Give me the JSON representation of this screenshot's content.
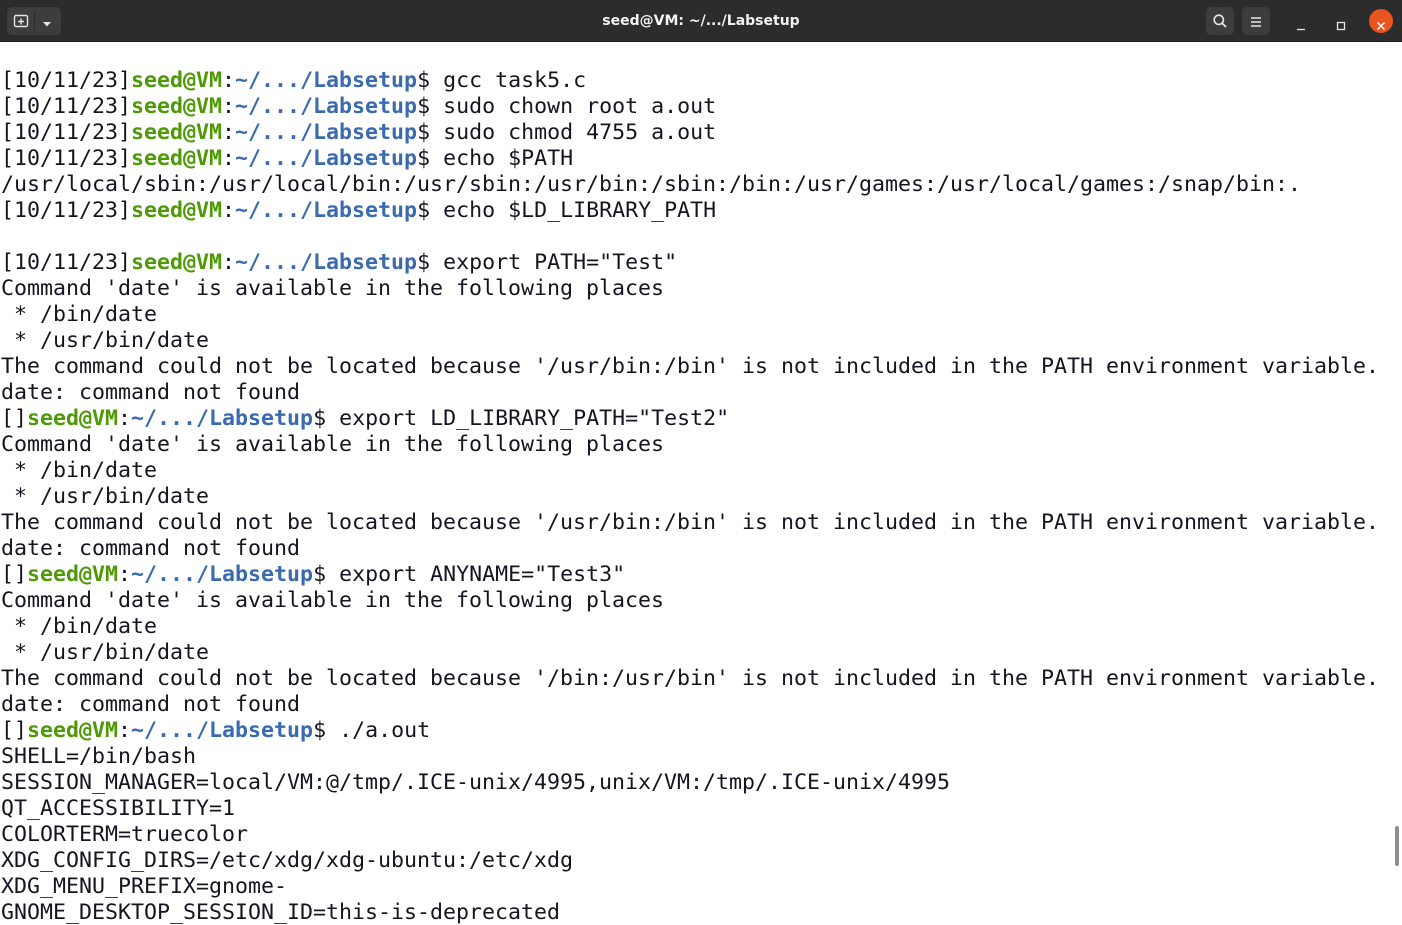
{
  "window": {
    "title": "seed@VM: ~/.../Labsetup"
  },
  "titlebar": {
    "new_tab_icon": "new-tab-icon",
    "tab_menu_icon": "chevron-down-icon",
    "search_icon": "search-icon",
    "menu_icon": "hamburger-menu-icon",
    "minimize_icon": "minimize-icon",
    "maximize_icon": "maximize-icon",
    "close_icon": "close-icon",
    "close_color": "#e95420"
  },
  "colors": {
    "user_host": "#4e9a06",
    "path": "#3a6bb0",
    "text": "#171421"
  },
  "terminal": {
    "lines": [
      {
        "type": "prompt",
        "date": "[10/11/23]",
        "user": "seed@VM",
        "sep": ":",
        "path": "~/.../Labsetup",
        "sym": "$ ",
        "cmd": "gcc task5.c"
      },
      {
        "type": "prompt",
        "date": "[10/11/23]",
        "user": "seed@VM",
        "sep": ":",
        "path": "~/.../Labsetup",
        "sym": "$ ",
        "cmd": "sudo chown root a.out"
      },
      {
        "type": "prompt",
        "date": "[10/11/23]",
        "user": "seed@VM",
        "sep": ":",
        "path": "~/.../Labsetup",
        "sym": "$ ",
        "cmd": "sudo chmod 4755 a.out"
      },
      {
        "type": "prompt",
        "date": "[10/11/23]",
        "user": "seed@VM",
        "sep": ":",
        "path": "~/.../Labsetup",
        "sym": "$ ",
        "cmd": "echo $PATH"
      },
      {
        "type": "text",
        "text": "/usr/local/sbin:/usr/local/bin:/usr/sbin:/usr/bin:/sbin:/bin:/usr/games:/usr/local/games:/snap/bin:."
      },
      {
        "type": "prompt",
        "date": "[10/11/23]",
        "user": "seed@VM",
        "sep": ":",
        "path": "~/.../Labsetup",
        "sym": "$ ",
        "cmd": "echo $LD_LIBRARY_PATH"
      },
      {
        "type": "text",
        "text": ""
      },
      {
        "type": "prompt",
        "date": "[10/11/23]",
        "user": "seed@VM",
        "sep": ":",
        "path": "~/.../Labsetup",
        "sym": "$ ",
        "cmd": "export PATH=\"Test\""
      },
      {
        "type": "text",
        "text": "Command 'date' is available in the following places"
      },
      {
        "type": "text",
        "text": " * /bin/date"
      },
      {
        "type": "text",
        "text": " * /usr/bin/date"
      },
      {
        "type": "text",
        "text": "The command could not be located because '/usr/bin:/bin' is not included in the PATH environment variable."
      },
      {
        "type": "text",
        "text": "date: command not found"
      },
      {
        "type": "prompt",
        "date": "[]",
        "user": "seed@VM",
        "sep": ":",
        "path": "~/.../Labsetup",
        "sym": "$ ",
        "cmd": "export LD_LIBRARY_PATH=\"Test2\""
      },
      {
        "type": "text",
        "text": "Command 'date' is available in the following places"
      },
      {
        "type": "text",
        "text": " * /bin/date"
      },
      {
        "type": "text",
        "text": " * /usr/bin/date"
      },
      {
        "type": "text",
        "text": "The command could not be located because '/usr/bin:/bin' is not included in the PATH environment variable."
      },
      {
        "type": "text",
        "text": "date: command not found"
      },
      {
        "type": "prompt",
        "date": "[]",
        "user": "seed@VM",
        "sep": ":",
        "path": "~/.../Labsetup",
        "sym": "$ ",
        "cmd": "export ANYNAME=\"Test3\""
      },
      {
        "type": "text",
        "text": "Command 'date' is available in the following places"
      },
      {
        "type": "text",
        "text": " * /bin/date"
      },
      {
        "type": "text",
        "text": " * /usr/bin/date"
      },
      {
        "type": "text",
        "text": "The command could not be located because '/bin:/usr/bin' is not included in the PATH environment variable."
      },
      {
        "type": "text",
        "text": "date: command not found"
      },
      {
        "type": "prompt",
        "date": "[]",
        "user": "seed@VM",
        "sep": ":",
        "path": "~/.../Labsetup",
        "sym": "$ ",
        "cmd": "./a.out"
      },
      {
        "type": "text",
        "text": "SHELL=/bin/bash"
      },
      {
        "type": "text",
        "text": "SESSION_MANAGER=local/VM:@/tmp/.ICE-unix/4995,unix/VM:/tmp/.ICE-unix/4995"
      },
      {
        "type": "text",
        "text": "QT_ACCESSIBILITY=1"
      },
      {
        "type": "text",
        "text": "COLORTERM=truecolor"
      },
      {
        "type": "text",
        "text": "XDG_CONFIG_DIRS=/etc/xdg/xdg-ubuntu:/etc/xdg"
      },
      {
        "type": "text",
        "text": "XDG_MENU_PREFIX=gnome-"
      },
      {
        "type": "text",
        "text": "GNOME_DESKTOP_SESSION_ID=this-is-deprecated"
      }
    ]
  },
  "scrollbar": {
    "position_fraction": 0.93
  }
}
